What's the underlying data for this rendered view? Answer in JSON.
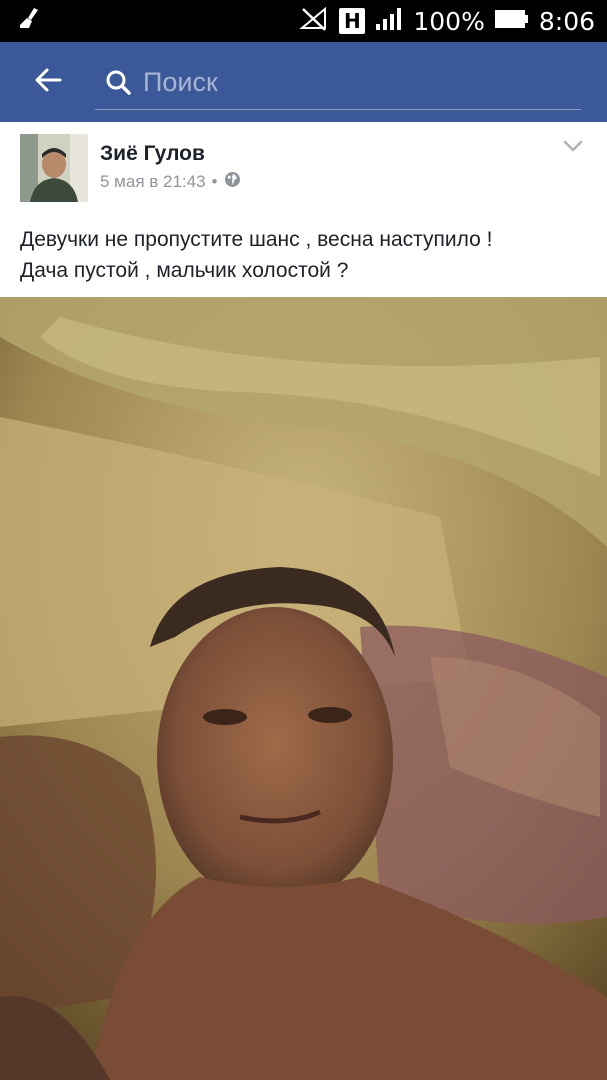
{
  "status_bar": {
    "battery_percent": "100%",
    "time": "8:06",
    "network_badge": "H",
    "icons": [
      "broom-icon",
      "no-signal-icon",
      "network-h-icon",
      "signal-bars-icon",
      "battery-icon"
    ]
  },
  "app_bar": {
    "search_placeholder": "Поиск",
    "background_color": "#3b5998",
    "icons": [
      "back-arrow-icon",
      "search-icon"
    ]
  },
  "post": {
    "author": "Зиё Гулов",
    "date": "5 мая в 21:43",
    "separator": "•",
    "privacy_icon": "globe-icon",
    "menu_icon": "chevron-down-icon",
    "text_lines": [
      "Девучки не пропустите шанс , весна наступило !",
      "Дача пустой , мальчик холостой ?"
    ]
  }
}
